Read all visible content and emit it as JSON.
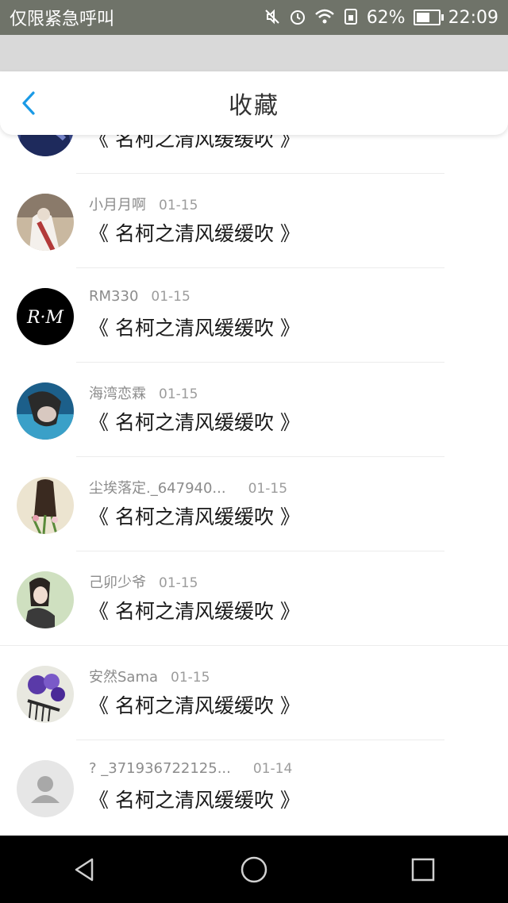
{
  "status_bar": {
    "carrier": "仅限紧急呼叫",
    "battery": "62%",
    "battery_level": 0.62,
    "time": "22:09",
    "icons": [
      "mute-icon",
      "alarm-icon",
      "wifi-icon",
      "sim-icon",
      "battery-icon"
    ]
  },
  "header": {
    "title": "收藏",
    "back_icon": "chevron-left-icon",
    "accent": "#1a9ae6"
  },
  "items": [
    {
      "username": "",
      "date": "",
      "title": "《 名柯之清风缓缓吹 》",
      "avatar": "partial"
    },
    {
      "username": "小月月啊",
      "date": "01-15",
      "title": "《 名柯之清风缓缓吹 》",
      "avatar": "anime"
    },
    {
      "username": "RM330",
      "date": "01-15",
      "title": "《 名柯之清风缓缓吹 》",
      "avatar": "rm",
      "avatar_text": "R·M"
    },
    {
      "username": "海湾恋霖",
      "date": "01-15",
      "title": "《 名柯之清风缓缓吹 》",
      "avatar": "blue"
    },
    {
      "username": "尘埃落定._647940...",
      "date": "01-15",
      "title": "《 名柯之清风缓缓吹 》",
      "avatar": "beige"
    },
    {
      "username": "己卯少爷",
      "date": "01-15",
      "title": "《 名柯之清风缓缓吹 》",
      "avatar": "green"
    },
    {
      "username": "安然Sama",
      "date": "01-15",
      "title": "《 名柯之清风缓缓吹 》",
      "avatar": "flower"
    },
    {
      "username": "? _371936722125...",
      "date": "01-14",
      "title": "《 名柯之清风缓缓吹 》",
      "avatar": "default"
    }
  ],
  "nav_bar": {
    "buttons": [
      "back-triangle-icon",
      "home-circle-icon",
      "recents-square-icon"
    ]
  }
}
